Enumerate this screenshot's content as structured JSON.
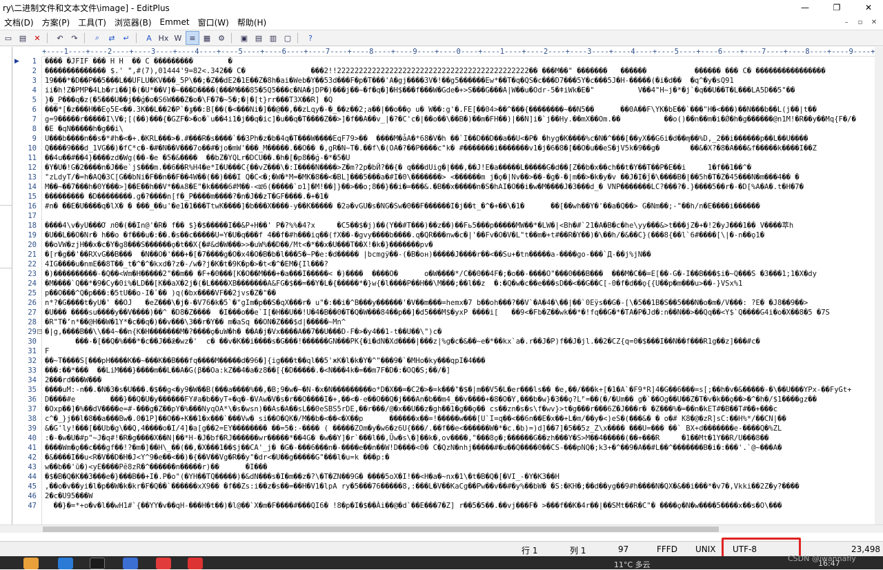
{
  "window": {
    "title": "ry\\二进制文件和文本文件\\image] - EditPlus",
    "minimize_icon": "—",
    "maximize_icon": "❐",
    "close_icon": "✕"
  },
  "menu": [
    "文档(D)",
    "方案(P)",
    "工具(T)",
    "浏览器(B)",
    "Emmet",
    "窗口(W)",
    "帮助(H)"
  ],
  "mdi_controls": [
    "–",
    "▫",
    "✕"
  ],
  "toolbar_icons": [
    "new-file-icon",
    "open-icon",
    "close-doc-icon",
    "undo-icon",
    "redo-icon",
    "find-icon",
    "replace-icon",
    "word-wrap-icon",
    "font-icon",
    "hex-icon",
    "w-icon",
    "spell-icon",
    "cliptext-icon",
    "directory-icon",
    "toggle-icon",
    "preview-icon",
    "settings-icon",
    "help-icon"
  ],
  "ruler": "+----1----+----2----+----3----+----4----+----5----+----6----+----7----+----8----+----9----+----0----+----1----+----2----+----3----+----4----+----5----+----6----+----7----+----8----+----9----+",
  "lines": [
    {
      "n": "1",
      "t": "���� �JFIF ��� H H  �� C ���������        �"
    },
    {
      "n": "2",
      "t": "�������������� $.' \",#(7),01444'9=82<.342�� C�               ���2!!22222222222222222222222222222222222222222222�� ���M��\" �������   ������           ������ ��� C� ����������������"
    },
    {
      "n": "3",
      "t": "19���*�D��P��5���L��UFLU�KV���_5P\\��;�Z��dE2�1E��Z�8h�ai�Web�Y��53d���F�p�T���'A�gj����3V�!��g5������Ew*��T�q�QS�c���D7���5Y�c���5J�H-�����(�i�d��  �q^�y�sQ91"
    },
    {
      "n": "4",
      "t": "ii�h!Z�PMP�4Lb�ri��]�(�U*��V]�~���D����(���M���85�5Q5���c�NA�jDP�)���j��~�f�q�]�H$���f���W�Gde�+>S���G���A|W��u�Odr-5�ǂiWk�E�\"          V��4\"H~j�*�j`�q��U��T�L���LA5D��5\"��"
    },
    {
      "n": "5",
      "t": "}�_P���q�z(�5���U��j��ǵ�o�S6W���Z�o�\\F�7�~5�;�|�[t}rr���T3X��R] �Q"
    },
    {
      "n": "6",
      "t": "���*[�z���H��Eǫ5E<��.3K��L��2�P`�ٷ��:B[��(�<���Ni�]��@��,��zLqy�-�_��z��2;a��|��o��ǫ u� W��:g'�.FE[��04>��^���{��������~��N5��      ��0A��F\\YK�bE��`���\"H�<���)��N���b��L(j��|t��"
    },
    {
      "n": "7",
      "t": "g=9�����r�����I\\V�;[(��)���{�GZF�>�o�`u��4i1�j��q�ic]�u��q�T����Z��>]�f��A��v_|�?�C'c�|��o��\\��B�)��m�FH��)|��N]i�`j��Hy.��mX��Om.��          ��o()��n��m�i�Ǿ�h�g������@n1M!�R��y��Mq{F�/�"
    },
    {
      "n": "8",
      "t": "�E �qN�����h�g��i\\"
    },
    {
      "n": "9",
      "t": "U���b����n��s�*#h�<�+.�KRL���>�.#���R�s����`��3Ph�z�b�4q�T���W����EqF79>��  ����M�ǡA�*68�V�h ��`I��D��D��a��U<�P� �hyg�K����%c�N�^���[��yX��G6i�d��ɱ��%D,_2��i������p��L��U����"
    },
    {
      "n": "10",
      "t": "Q����9���d_1VG��)�fC*c�-�#�N��V���7o��#�jo�mW'���_M�����.��O�� �,gR�N~T�.��f\\�(OA�?��P����c\"k� #�������i�������v1�j�6�8�[��O�u��eS�jV5k�9��g�       ��&�X?�8�A���&f�����k����I��Z"
    },
    {
      "n": "11",
      "t": "��4u��#��4}����zd�Wg(��-�e �5�&����  ��bZ�YQLr�DCU��.�h�[�p8��ǵ-�*�5�U"
    },
    {
      "n": "12",
      "t": "�Y�U�!G�2����n�J��e`j$���m.��6��R%H4�e*I�U���C{��vZ���\\�:I����N����>Z�m?2p�bЙ?��{� q���dUig�|���,��J!E�a�����L�����G�d��[Z��b�x��ch��t�Y��T��P�E��i     1�f��1��^�"
    },
    {
      "n": "13",
      "t": "\"zLdyT/�=h�AQ�3C[G��bNi�F��n��F��4W��(��)���I Q�C<�;�W�*M=�MK�8��<�BL]���5���a�#I�0\\�������> <������m j�ǫ�|Nv��>��-�g�-�|m��>�k�y�v ��J�I�ǰ�\\����B�|��5h�T�Z�45���N�m���4�� �"
    },
    {
      "n": "14",
      "t": "M��~��7���h�0Y���>]��E��h��V*��Ѧ8�E\"�k����6#M��-<ǅ6(�����`ɒ1]�M!��]}��>��o;8��}��i�=���&.�B��x�����n�S�hAI�O��i�w�M����J�3���d_� VNP�������LC?���?�.}����5��r�-�D[%A�A�.t�H�7�"
    },
    {
      "n": "15",
      "t": "��������� �D��������.g�?����n[f�_P����m����?�n�J��zT�GF����.�+�1�"
    },
    {
      "n": "16",
      "t": "#n� ��E�U����q�lX� � ���_��u'�e1�1���TtwK����]�b���X����-y��K����� �2ə�vGU�s�NG�Sw�0��F������I�j��t_�^�+��\\�1�      ��[��wh��Y�'��a�Q��> G�Nm��;-\"��h/n�E����i������"
    },
    {
      "n": "17",
      "t": ""
    },
    {
      "n": "18",
      "t": "����4\\v�yU���Ơ лΘ�(��In@'�R� f�� $}�$�����I��&P+H��' P�?%%�4?x     �C5��$�j)��(Y��#T���)��z��)��Fь5���p�����MW��*�LW�|<Bh�#`21�A�B�c�he\\yy���&>t���jZ�+�!2�yJ���1�� V����萃h"
    },
    {
      "n": "19",
      "t": "�U��L��O�Nr� h��o �f���u�:��.�s��c�����U=Y�U�q���f 4��f�#h���iq��(fX��-�gvy����b����.q�QR���nw�c�|'��Fv�O�V�L\"t��m�+t#��R�Y��)�\\��h/�&��C}(���8{��l`6#����[\\|�-n��ǫ1�"
    },
    {
      "n": "20",
      "t": "��oVW�zjH��x�c�Y�g8���S������ǫ�t��X{�#&d�W���>>�uW%��D��/Mt<�*��x�U���T��X!�k�}�������pv�"
    },
    {
      "n": "21",
      "t": "�[r�g��'��RXvG��B���  �N��O�'���+�[�7����g�O�x4�O�B�b�l���5�~P�e:�d����� |bcmgÿ��-(�B�oн)�����J����r��<��Sս+�tn�����a-����go-���`Д-��j%jN��"
    },
    {
      "n": "22",
      "t": "4IG����u�nmE��8T��_t�^�^�kxd�?z�-/w�?j�K�t�9K�p�>�t<�^�EM�{Il���?"
    },
    {
      "n": "23",
      "t": "�)����������-�Q��<Wm�H�����2\"��m�� �F+�0���[K�O��M���+�a���I�����< �)����  ����O�      o�W����*/C��0��4F�;�o��-����O\"���0���B���  ���M�C��=E[��-G�-I��B���$i�~Q���S �3���1;1�X�dy"
    },
    {
      "n": "24",
      "t": "�M����`Q��*�9�Cy�0i%�LD��[K��aX�2j�(�L����XB�������A&FG�$��=��Y�L�{�����*�}w{�l����P��H��\\M���;��l��z  �:�Q�w�c��e���sD��<��G��C[-0�f�d��ǫ{{U��p�m���u>��-}VSx%1"
    },
    {
      "n": "25",
      "t": "p��O���^Q�p���:�5tU��o-I�ʹ�� )q(�bx����VF��2jvs�Z�\"��"
    },
    {
      "n": "26",
      "t": "n*?�G����t�yU�' ��OJ   �eZ���\\�j�-�V76�k�5`�\"gIm�p��S�qX���r� u\"�:��i�^B���y������'�V��m���=hemx�7 b��oh���?��V`�A�4�\\��|��`0Eÿs��G�-[\\�5��1B�S��5���N�o�m�/V���: ?E� �J8��9��>"
    },
    {
      "n": "27",
      "t": "�U��� ����su����y��V����)��^ �D8�Z����  �I���o��e`I[�H��U��!U�4�B��0�T�Q�W���84��p��]�d5���M$�yxP ����i[   ��9<�Fb�Z��wk��*�!fq��G�*�TA�P�Jd�:n��N��>��Qq��<Y$`Q����G4i�o�X��8�5 �7S"
    },
    {
      "n": "28",
      "t": "�R\"T�ʼn*��@H��W�1Y*�c��q�)��v���\\3��r�Y�� m�aSq ��ON�Z���$d|�����~Mn^"
    },
    {
      "n": "29",
      "t": "�|g,����B��\\\\��4~��n{K�H�������M�?����ǫ�uW�h� ��A�j�Vx����A��7��U���D-F�>�y4��1-t��U��\\\")c�"
    },
    {
      "n": "30",
      "t": "       ���-�[��Q�%���*�c��J��ǣ�wz�'  c� ��v�K��i����s�G���!������GN���PK{�i�dN�Xd����|���z|%g�c�&��~e�*��kx`a�.r��J�P)f��J�jl.��2�CZ{q=0�$���I��N��f���R1g��z]���#c�"
    },
    {
      "n": "31",
      "t": "F"
    },
    {
      "n": "32",
      "t": "��~T����S[���pH����K��~���K��B���fq����M�����d�96�]{ig���t��ql��5'жK�l�k�Y�^\"���9�`�MHo�ky���qpI�4���"
    },
    {
      "n": "33",
      "t": "���:��*���  ��LiM���}����m��L��A�G(β��Oa:kZ��4�a�z8��[{�D�����.�<N���4k�=��m7F�D�:�OQ�S;��/�]"
    },
    {
      "n": "34",
      "t": "2���rd���W���"
    },
    {
      "n": "35",
      "t": "����uM:-n��.�N�3�s�U���.�$��g<�y9�W��B(���a����%��,�B;9�w�~�N-�x�N���������o*D�X��=�C2�>�=k���\"�$�|m��V5�L�er���ls�� �e,��/���k+[�1�A`�F9*R]4�G��6���=s[;��h�v�&�����-�\\��U���YPx-��FyGt+"
    },
    {
      "n": "36",
      "t": "D����#e        ���}��Q�U�y������FY#a�b��yT+�q�-�VAw�V�s�r��O����I�+,��<�-e��O��Q�j���An�b��m4_��v����+�8�O�Y,���b�w}�3��ǫ?Lᴾ=��(�/�Um�� g�`��Og��U��Z�T�v�k��ǫ��>�^�h�/$1����gz��"
    },
    {
      "n": "37",
      "t": "�Oxp��]�%��dV����e=#-���g�Z��pY�%���NyqOA*\\�s�wsn)��As�A��sL��0eSBS5rDE,��r���/@�x��U��z�gh��1�g��ǫ�� cs��zn�s�s\\f�wv}>t�g���r���6Z�J���r� �Z���%�=��n�kET#�B��T#��+���c"
    },
    {
      "n": "38",
      "t": "c^�_}j��l�8��a���Bw�.0�1P]��O��+K��1�x���`���Vw� si��O�QK�/M��b�<��<�X��p      ������x��=!�����w���[U`I=q��<��6n��E�x��+L�m/��y�<)eS�(���&� � o�# K8�@�zR]sC:��H%*/��CN|��"
    },
    {
      "n": "39",
      "t": "&�G'ly!���[��Ub�g\\��Q,4����o�I/4]�a[g��2=EY�������� ��=5�:-���� ( �����ZOm�y�w6�z6U{���/.��f��e<������W�*�c.�b)=)d]��7]�5��5z_Z\\x���� ���U=��� ��` BX+d�������e-����Q�%ZL"
    },
    {
      "n": "40",
      "t": ":�-�w�U�#p\"~J�q#!�R�g����X��N|��*H-�J�bf�RJ������wr�����*��4G� �w��Y]�r`���l��,Ȗw�s\\�]��k�,ov����,\"���8ǫ�;������G��zh���Y�S>M��4�����(��+���R     �1��Mt�1Y��R/U���8��"
    },
    {
      "n": "41",
      "t": "����Wm�ǫ��c���gf��!?�m�]��H\\_��(��,�X���1��$j��CA'_j� �G�-���6���n�-����e��n��W!D����<0� C�QzN�nhj�����#�u��Q����0��CS-���pNQ�;k3+�^��9�A��#L��^�������B�i�:���'.`@~���A�"
    },
    {
      "n": "42",
      "t": "�&����I��u<R�V��D�H�J<Y^9�e��<��)�{��V��Vg�R��y\"�dr<�U��g�����G\"���l�u=k ���p:�"
    },
    {
      "n": "43",
      "t": "w��b��'ū�)<yE����Pȇ8zR�^������n�����r)��      �I���"
    },
    {
      "n": "44",
      "t": "�$�B�Q�K��3���e�}���B��+I�.P�o\"(�YH��TQ�����)�&dN���s�I�m��z�?\\�T�ZN��9G� ����5oX�I!��<H�a�~nx�1\\�t�B�Q�[�VI_-�Y�K3��H"
    },
    {
      "n": "45",
      "t": ",��o�v��yi�l�p��W�k�kr�F�Q��`������xX9�� �f��Zs:i��z�s��=��H�V1�lpA ry�5���76�����8,:���L�V��KaCg��Pw��v��#�y%��bW� �S:�KH�;��d��yg��9#h����N�QX�&��i���*�v7�,Vkki��2Z�y?����"
    },
    {
      "n": "46",
      "t": "2�c�U95���W"
    },
    {
      "n": "47",
      "t": "  ��}�=*+o�v�l��wH1#`{��YY�v��qH-���H�t��)�l@��`X�m�F����#���QI6� !8�p�I�$��Ài��@�d`��E���7�Z] r��5�5��.��vj���F� >���f��K�4r��|��SMt��R�C\"� ����ǫ�N�w����5����x��s�O\\���"
    }
  ],
  "status": {
    "line": "行 1",
    "col": "列 1",
    "num": "97",
    "code": "FFFD",
    "eol": "UNIX",
    "encoding": "UTF-8",
    "size": "23,498"
  },
  "taskbar": {
    "weather": "11°C 多云",
    "time": "16:47",
    "watermark": "CSDN @iwannafly"
  }
}
